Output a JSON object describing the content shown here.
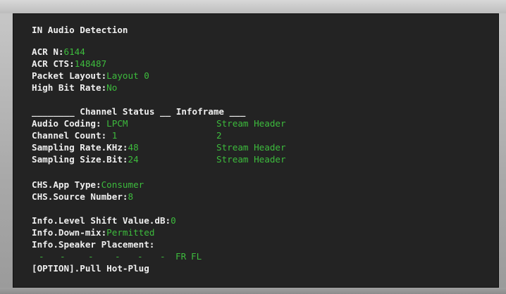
{
  "title": "IN Audio Detection",
  "acr": {
    "n_label": "ACR N:",
    "n_value": "6144",
    "cts_label": "ACR CTS:",
    "cts_value": "148487",
    "layout_label": "Packet Layout:",
    "layout_value": "Layout 0",
    "hbr_label": "High Bit Rate:",
    "hbr_value": "No"
  },
  "table": {
    "header_prefix": "________",
    "header_channel": " Channel Status ",
    "header_mid": "__",
    "header_infoframe": " Infoframe ",
    "header_suffix": "___",
    "rows": [
      {
        "label": "Audio Coding: ",
        "channel": "LPCM",
        "info": "Stream Header"
      },
      {
        "label": "Channel Count: ",
        "channel": "1",
        "info": "2"
      },
      {
        "label": "Sampling Rate.KHz:",
        "channel": "48",
        "info": "Stream Header"
      },
      {
        "label": "Sampling Size.Bit:",
        "channel": "24",
        "info": "Stream Header"
      }
    ]
  },
  "chs": {
    "app_label": "CHS.App Type:",
    "app_value": "Consumer",
    "src_label": "CHS.Source Number:",
    "src_value": "8"
  },
  "info": {
    "shift_label": "Info.Level Shift Value.dB:",
    "shift_value": "0",
    "downmix_label": "Info.Down-mix:",
    "downmix_value": "Permitted",
    "speaker_label": "Info.Speaker Placement:",
    "speaker_slots": [
      "-",
      "-",
      "-",
      "-",
      "-",
      "-",
      "FR",
      "FL"
    ]
  },
  "option": "[OPTION].Pull Hot-Plug",
  "colors": {
    "background": "#232323",
    "label": "#efefef",
    "value": "#3dbb3d"
  }
}
